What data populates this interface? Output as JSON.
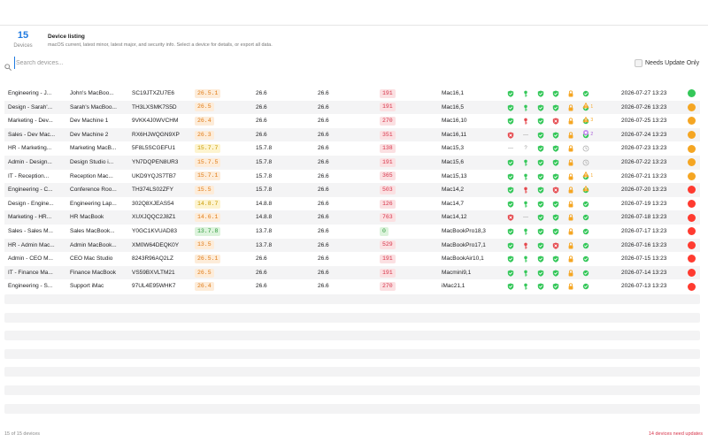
{
  "summary": {
    "count": "15",
    "count_label": "Devices",
    "title": "Device listing",
    "subtitle": "macOS current, latest minor, latest major, and security info. Select a device for details, or export all data."
  },
  "search": {
    "placeholder": "Search devices...",
    "filter_label": "Needs Update Only"
  },
  "colors": {
    "accent": "#1f7ae0",
    "ok": "#34c759",
    "warning": "#f5a623",
    "danger": "#e5484d",
    "alert": "#ff3b30"
  },
  "devices": [
    {
      "group": "Engineering - J...",
      "name": "John's MacBoo...",
      "serial": "SC19JTXZU7E6",
      "current": "26.5.1",
      "current_tone": "orange",
      "minor": "26.6",
      "major": "26.6",
      "security": "191",
      "security_tone": "red",
      "model": "Mac16,1",
      "icons": [
        "shield-ok",
        "key-ok",
        "shield-ok",
        "shield-ok",
        "lock-warn",
        "check-ok"
      ],
      "extra": "",
      "extra_count": "",
      "checkin": "2026-07-27 13:23",
      "status": "ok"
    },
    {
      "group": "Design - Sarah'...",
      "name": "Sarah's MacBoo...",
      "serial": "TH3LXSMK7S5D",
      "current": "26.5",
      "current_tone": "orange",
      "minor": "26.6",
      "major": "26.6",
      "security": "191",
      "security_tone": "red",
      "model": "Mac16,5",
      "icons": [
        "shield-ok",
        "key-ok",
        "shield-ok",
        "shield-ok",
        "lock-warn",
        "check-ok"
      ],
      "extra": "warning",
      "extra_count": "1",
      "checkin": "2026-07-26 13:23",
      "status": "warn"
    },
    {
      "group": "Marketing - Dev...",
      "name": "Dev Machine 1",
      "serial": "9VKK4J0WVCHM",
      "current": "26.4",
      "current_tone": "orange",
      "minor": "26.6",
      "major": "26.6",
      "security": "270",
      "security_tone": "red",
      "model": "Mac16,10",
      "icons": [
        "shield-ok",
        "key-bad",
        "shield-ok",
        "shield-bad",
        "lock-warn",
        "check-ok"
      ],
      "extra": "warning",
      "extra_count": "3",
      "checkin": "2026-07-25 13:23",
      "status": "warn"
    },
    {
      "group": "Sales - Dev Mac...",
      "name": "Dev Machine 2",
      "serial": "RX6HJWQGN9XP",
      "current": "26.3",
      "current_tone": "orange",
      "minor": "26.6",
      "major": "26.6",
      "security": "351",
      "security_tone": "red",
      "model": "Mac16,11",
      "icons": [
        "shield-bad",
        "dash",
        "shield-ok",
        "shield-ok",
        "lock-warn",
        "check-ok"
      ],
      "extra": "app",
      "extra_count": "2",
      "checkin": "2026-07-24 13:23",
      "status": "warn"
    },
    {
      "group": "HR - Marketing...",
      "name": "Marketing MacB...",
      "serial": "5F8L5SCGEFU1",
      "current": "15.7.7",
      "current_tone": "yellow",
      "minor": "15.7.8",
      "major": "26.6",
      "security": "138",
      "security_tone": "red",
      "model": "Mac15,3",
      "icons": [
        "dash",
        "question",
        "shield-ok",
        "shield-ok",
        "lock-warn",
        "clock"
      ],
      "extra": "",
      "extra_count": "",
      "checkin": "2026-07-23 13:23",
      "status": "warn"
    },
    {
      "group": "Admin - Design...",
      "name": "Design Studio i...",
      "serial": "YN7DQPEN8UR3",
      "current": "15.7.5",
      "current_tone": "orange",
      "minor": "15.7.8",
      "major": "26.6",
      "security": "191",
      "security_tone": "red",
      "model": "Mac15,6",
      "icons": [
        "shield-ok",
        "key-ok",
        "shield-ok",
        "shield-ok",
        "lock-warn",
        "clock"
      ],
      "extra": "",
      "extra_count": "",
      "checkin": "2026-07-22 13:23",
      "status": "warn"
    },
    {
      "group": "IT - Reception...",
      "name": "Reception Mac...",
      "serial": "UKD9YQJS7TB7",
      "current": "15.7.1",
      "current_tone": "orange",
      "minor": "15.7.8",
      "major": "26.6",
      "security": "365",
      "security_tone": "red",
      "model": "Mac15,13",
      "icons": [
        "shield-ok",
        "key-ok",
        "shield-ok",
        "shield-ok",
        "lock-warn",
        "check-ok"
      ],
      "extra": "warning",
      "extra_count": "1",
      "checkin": "2026-07-21 13:23",
      "status": "warn"
    },
    {
      "group": "Engineering - C...",
      "name": "Conference Roo...",
      "serial": "TH374LS02ZFY",
      "current": "15.5",
      "current_tone": "orange",
      "minor": "15.7.8",
      "major": "26.6",
      "security": "503",
      "security_tone": "red",
      "model": "Mac14,2",
      "icons": [
        "shield-ok",
        "key-bad",
        "shield-ok",
        "shield-bad",
        "lock-warn",
        "check-ok"
      ],
      "extra": "warning",
      "extra_count": "",
      "checkin": "2026-07-20 13:23",
      "status": "bad"
    },
    {
      "group": "Design - Engine...",
      "name": "Engineering Lap...",
      "serial": "302Q8XJEAS54",
      "current": "14.8.7",
      "current_tone": "yellow",
      "minor": "14.8.8",
      "major": "26.6",
      "security": "126",
      "security_tone": "red",
      "model": "Mac14,7",
      "icons": [
        "shield-ok",
        "key-ok",
        "shield-ok",
        "shield-ok",
        "lock-warn",
        "check-ok"
      ],
      "extra": "",
      "extra_count": "",
      "checkin": "2026-07-19 13:23",
      "status": "bad"
    },
    {
      "group": "Marketing - HR...",
      "name": "HR MacBook",
      "serial": "XUXJQQC2J8Z1",
      "current": "14.6.1",
      "current_tone": "orange",
      "minor": "14.8.8",
      "major": "26.6",
      "security": "763",
      "security_tone": "red",
      "model": "Mac14,12",
      "icons": [
        "shield-bad",
        "dash",
        "shield-ok",
        "shield-ok",
        "lock-warn",
        "check-ok"
      ],
      "extra": "",
      "extra_count": "",
      "checkin": "2026-07-18 13:23",
      "status": "bad"
    },
    {
      "group": "Sales - Sales M...",
      "name": "Sales MacBook...",
      "serial": "Y0GC1KVUAD83",
      "current": "13.7.8",
      "current_tone": "green",
      "minor": "13.7.8",
      "major": "26.6",
      "security": "0",
      "security_tone": "green",
      "model": "MacBookPro18,3",
      "icons": [
        "shield-ok",
        "key-ok",
        "shield-ok",
        "shield-ok",
        "lock-warn",
        "check-ok"
      ],
      "extra": "",
      "extra_count": "",
      "checkin": "2026-07-17 13:23",
      "status": "bad"
    },
    {
      "group": "HR - Admin Mac...",
      "name": "Admin MacBook...",
      "serial": "XM0W64DEQK0Y",
      "current": "13.5",
      "current_tone": "orange",
      "minor": "13.7.8",
      "major": "26.6",
      "security": "529",
      "security_tone": "red",
      "model": "MacBookPro17,1",
      "icons": [
        "shield-ok",
        "key-bad",
        "shield-ok",
        "shield-bad",
        "lock-warn",
        "check-ok"
      ],
      "extra": "",
      "extra_count": "",
      "checkin": "2026-07-16 13:23",
      "status": "bad"
    },
    {
      "group": "Admin - CEO M...",
      "name": "CEO Mac Studio",
      "serial": "8243R96AQ2LZ",
      "current": "26.5.1",
      "current_tone": "orange",
      "minor": "26.6",
      "major": "26.6",
      "security": "191",
      "security_tone": "red",
      "model": "MacBookAir10,1",
      "icons": [
        "shield-ok",
        "key-ok",
        "shield-ok",
        "shield-ok",
        "lock-warn",
        "check-ok"
      ],
      "extra": "",
      "extra_count": "",
      "checkin": "2026-07-15 13:23",
      "status": "bad"
    },
    {
      "group": "IT - Finance Ma...",
      "name": "Finance MacBook",
      "serial": "VS59BXVLTM21",
      "current": "26.5",
      "current_tone": "orange",
      "minor": "26.6",
      "major": "26.6",
      "security": "191",
      "security_tone": "red",
      "model": "Macmini9,1",
      "icons": [
        "shield-ok",
        "key-ok",
        "shield-ok",
        "shield-ok",
        "lock-warn",
        "check-ok"
      ],
      "extra": "",
      "extra_count": "",
      "checkin": "2026-07-14 13:23",
      "status": "bad"
    },
    {
      "group": "Engineering - S...",
      "name": "Support iMac",
      "serial": "97UL4E95WHK7",
      "current": "26.4",
      "current_tone": "orange",
      "minor": "26.6",
      "major": "26.6",
      "security": "270",
      "security_tone": "red",
      "model": "iMac21,1",
      "icons": [
        "shield-ok",
        "key-ok",
        "shield-ok",
        "shield-ok",
        "lock-warn",
        "check-ok"
      ],
      "extra": "",
      "extra_count": "",
      "checkin": "2026-07-13 13:23",
      "status": "bad"
    }
  ],
  "footer": {
    "left": "15 of 15 devices",
    "right": "14 devices need updates"
  }
}
